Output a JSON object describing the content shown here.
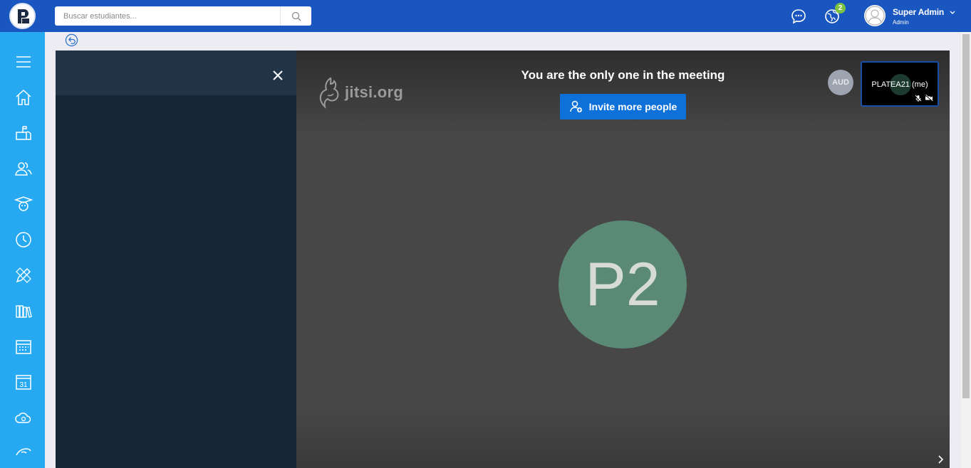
{
  "header": {
    "search_placeholder": "Buscar estudiantes...",
    "notification_count": "2",
    "user_name": "Super Admin",
    "user_role": "Admin"
  },
  "sidebar": {
    "items": [
      "menu-icon",
      "home-icon",
      "mailbox-icon",
      "users-icon",
      "graduate-icon",
      "clock-icon",
      "pencil-ruler-icon",
      "books-icon",
      "schedule-icon",
      "calendar-icon",
      "cloud-icon",
      "hand-icon"
    ]
  },
  "meeting": {
    "logo_text": "jitsi.org",
    "status_message": "You are the only one in the meeting",
    "invite_label": "Invite more people",
    "audio_badge": "AUD",
    "self_name": "PLATEA21 (me)",
    "main_initials": "P2"
  },
  "colors": {
    "topbar": "#1a56bf",
    "sidebar": "#26a9f0",
    "invite_button": "#0e71d9",
    "avatar": "#5a8a76",
    "chat_panel": "#172637"
  }
}
